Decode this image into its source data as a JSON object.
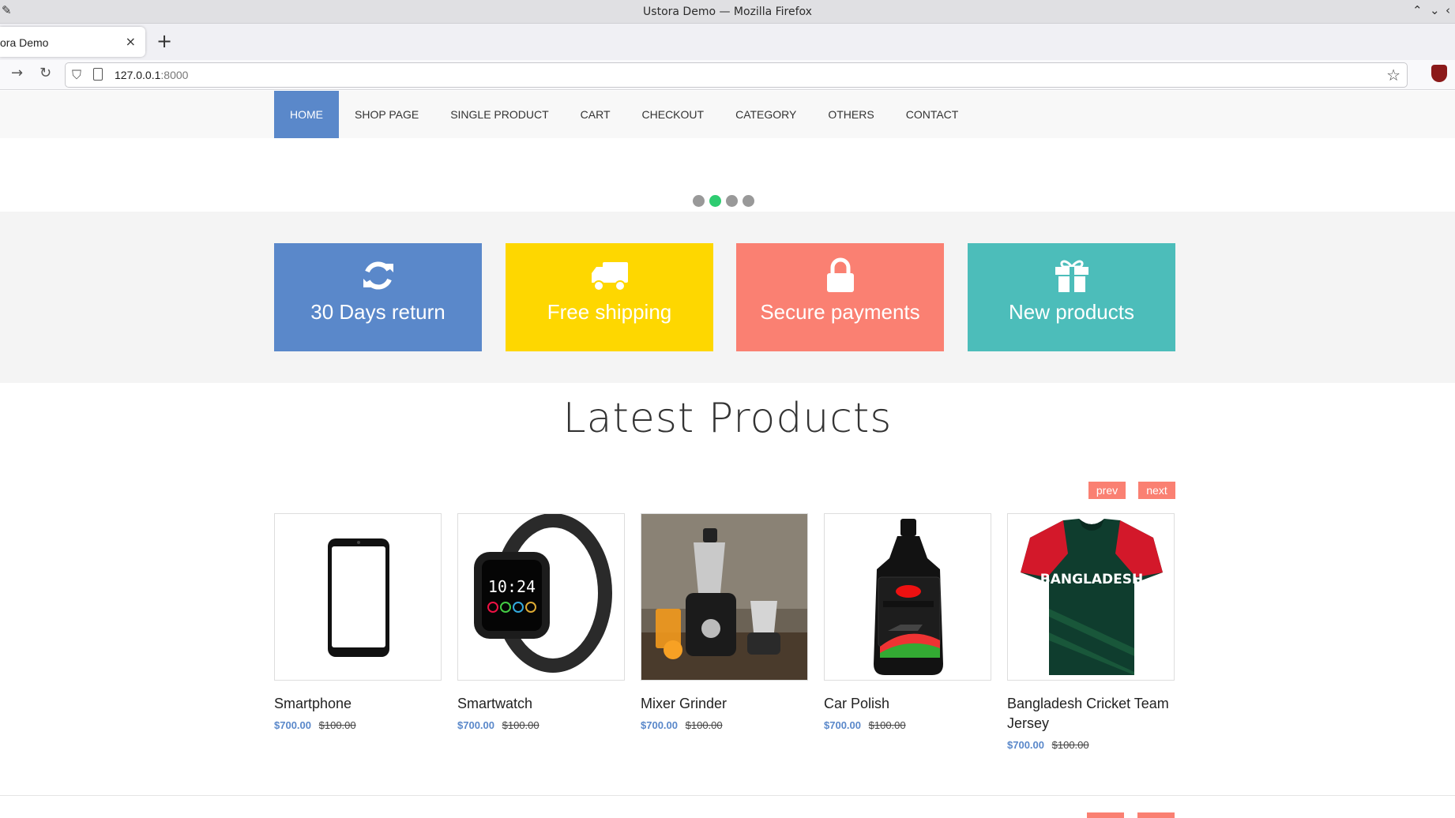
{
  "window": {
    "title": "Ustora Demo — Mozilla Firefox"
  },
  "tab": {
    "title": "ora Demo",
    "close_glyph": "×",
    "new_tab_glyph": "+"
  },
  "urlbar": {
    "host": "127.0.0.1",
    "port": ":8000"
  },
  "nav": {
    "items": [
      {
        "label": "HOME",
        "active": true
      },
      {
        "label": "SHOP PAGE"
      },
      {
        "label": "SINGLE PRODUCT"
      },
      {
        "label": "CART"
      },
      {
        "label": "CHECKOUT"
      },
      {
        "label": "CATEGORY"
      },
      {
        "label": "OTHERS"
      },
      {
        "label": "CONTACT"
      }
    ]
  },
  "slider": {
    "dot_count": 4,
    "active_index": 1,
    "active_color": "#2ecc71"
  },
  "promos": [
    {
      "label": "30 Days return",
      "icon": "refresh-icon",
      "color": "#5a88ca"
    },
    {
      "label": "Free shipping",
      "icon": "truck-icon",
      "color": "#fed700"
    },
    {
      "label": "Secure payments",
      "icon": "lock-icon",
      "color": "#fa8072"
    },
    {
      "label": "New products",
      "icon": "gift-icon",
      "color": "#4cbdba"
    }
  ],
  "latest": {
    "title": "Latest Products",
    "prev_label": "prev",
    "next_label": "next"
  },
  "products": [
    {
      "name": "Smartphone",
      "price": "$700.00",
      "old_price": "$100.00",
      "image": "smartphone-image"
    },
    {
      "name": "Smartwatch",
      "price": "$700.00",
      "old_price": "$100.00",
      "image": "smartwatch-image"
    },
    {
      "name": "Mixer Grinder",
      "price": "$700.00",
      "old_price": "$100.00",
      "image": "mixer-grinder-image"
    },
    {
      "name": "Car Polish",
      "price": "$700.00",
      "old_price": "$100.00",
      "image": "car-polish-image"
    },
    {
      "name": "Bangladesh Cricket Team Jersey",
      "price": "$700.00",
      "old_price": "$100.00",
      "image": "jersey-image",
      "image_text": "BANGLADESH"
    }
  ],
  "colors": {
    "accent_blue": "#5a88ca",
    "accent_salmon": "#fa8072"
  }
}
